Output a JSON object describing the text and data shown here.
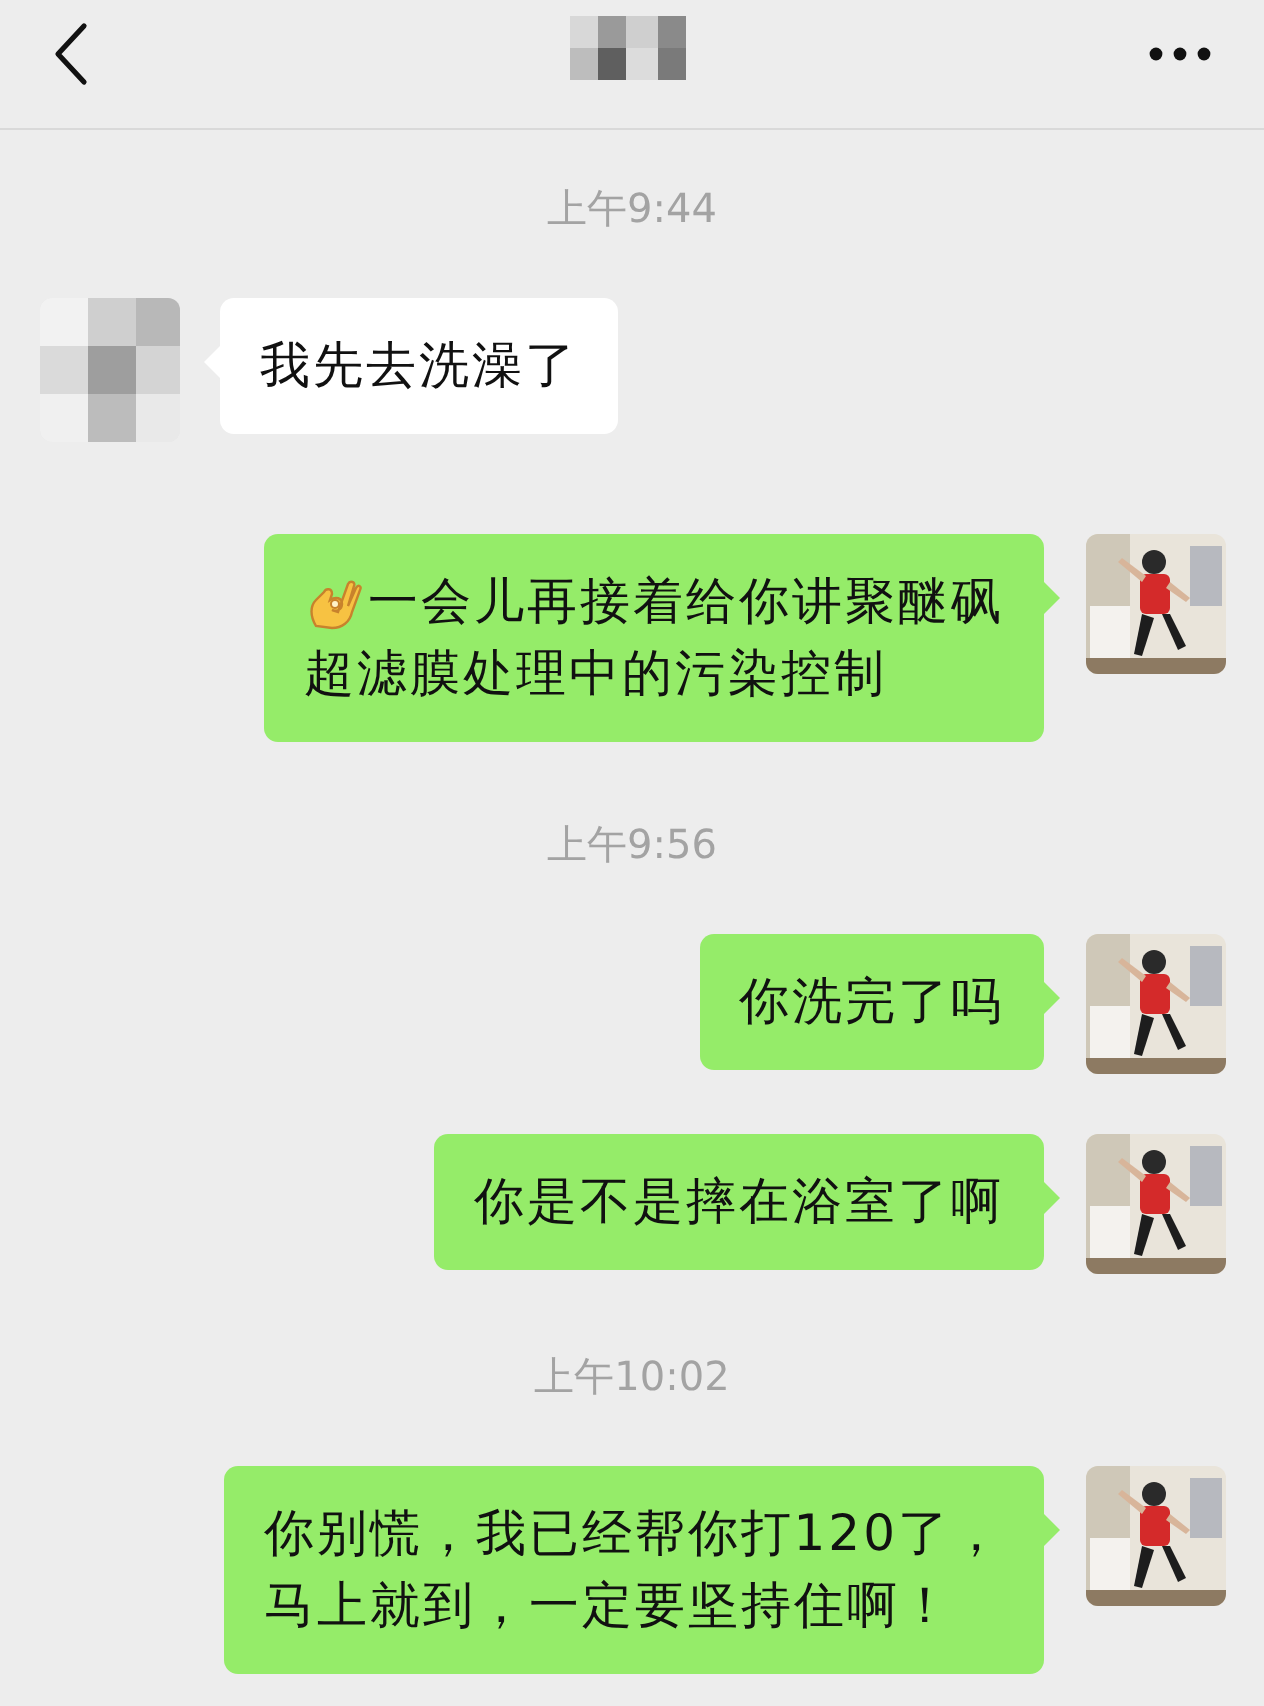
{
  "messages": [
    {
      "kind": "time",
      "text": "上午9:44"
    },
    {
      "kind": "received",
      "has_emoji": false,
      "lines": [
        "我先去洗澡了"
      ]
    },
    {
      "kind": "sent",
      "has_emoji": true,
      "lines": [
        "一会儿再接着给你讲聚醚砜",
        "超滤膜处理中的污染控制"
      ]
    },
    {
      "kind": "time",
      "text": "上午9:56"
    },
    {
      "kind": "sent",
      "has_emoji": false,
      "lines": [
        "你洗完了吗"
      ]
    },
    {
      "kind": "sent",
      "has_emoji": false,
      "lines": [
        "你是不是摔在浴室了啊"
      ]
    },
    {
      "kind": "time",
      "text": "上午10:02"
    },
    {
      "kind": "sent",
      "has_emoji": false,
      "lines": [
        "你别慌，我已经帮你打120了，",
        "马上就到，一定要坚持住啊！"
      ]
    }
  ]
}
